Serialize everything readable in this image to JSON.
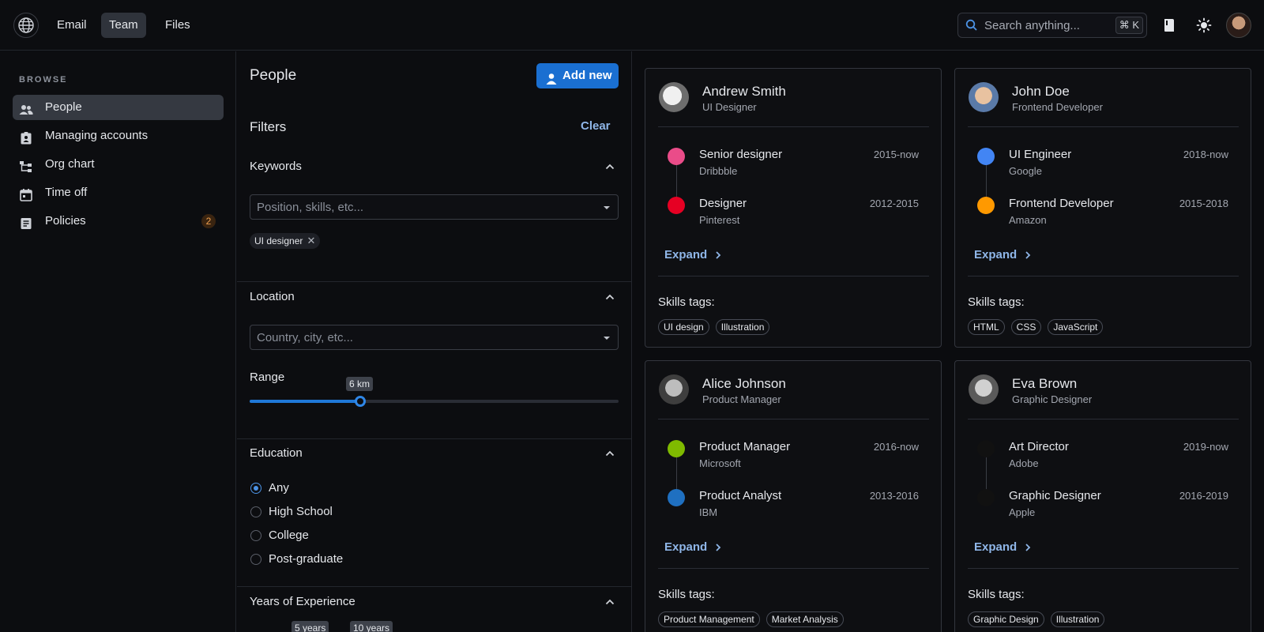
{
  "topbar": {
    "nav": [
      {
        "label": "Email",
        "active": false
      },
      {
        "label": "Team",
        "active": true
      },
      {
        "label": "Files",
        "active": false
      }
    ],
    "search": {
      "placeholder": "Search anything...",
      "shortcut": "⌘ K"
    },
    "icons": [
      "globe-icon",
      "book-icon",
      "sun-icon",
      "avatar"
    ]
  },
  "sidebar": {
    "section_label": "BROWSE",
    "items": [
      {
        "label": "People",
        "icon": "people-icon",
        "active": true
      },
      {
        "label": "Managing accounts",
        "icon": "badge-icon"
      },
      {
        "label": "Org chart",
        "icon": "org-chart-icon"
      },
      {
        "label": "Time off",
        "icon": "calendar-icon"
      },
      {
        "label": "Policies",
        "icon": "document-icon",
        "badge": "2"
      }
    ]
  },
  "filters": {
    "page_title": "People",
    "add_button": "Add new",
    "title": "Filters",
    "clear": "Clear",
    "keywords": {
      "heading": "Keywords",
      "placeholder": "Position, skills, etc...",
      "chips": [
        "UI designer"
      ]
    },
    "location": {
      "heading": "Location",
      "placeholder": "Country, city, etc...",
      "range_label": "Range",
      "range_value": "6 km",
      "range_fraction": 0.3
    },
    "education": {
      "heading": "Education",
      "options": [
        "Any",
        "High School",
        "College",
        "Post-graduate"
      ],
      "selected": "Any"
    },
    "experience": {
      "heading": "Years of Experience",
      "min_label": "5 years",
      "max_label": "10 years"
    }
  },
  "accent_color": "#1a6fd1",
  "cards": [
    {
      "name": "Andrew Smith",
      "role": "UI Designer",
      "jobs": [
        {
          "title": "Senior designer",
          "company": "Dribbble",
          "dates": "2015-now",
          "color": "#ea4c89"
        },
        {
          "title": "Designer",
          "company": "Pinterest",
          "dates": "2012-2015",
          "color": "#e60023"
        }
      ],
      "expand": "Expand",
      "skills_label": "Skills tags:",
      "tags": [
        "UI design",
        "Illustration"
      ]
    },
    {
      "name": "John Doe",
      "role": "Frontend Developer",
      "jobs": [
        {
          "title": "UI Engineer",
          "company": "Google",
          "dates": "2018-now",
          "color": "#4285f4"
        },
        {
          "title": "Frontend Developer",
          "company": "Amazon",
          "dates": "2015-2018",
          "color": "#ff9900"
        }
      ],
      "expand": "Expand",
      "skills_label": "Skills tags:",
      "tags": [
        "HTML",
        "CSS",
        "JavaScript"
      ]
    },
    {
      "name": "Alice Johnson",
      "role": "Product Manager",
      "jobs": [
        {
          "title": "Product Manager",
          "company": "Microsoft",
          "dates": "2016-now",
          "color": "#7fba00"
        },
        {
          "title": "Product Analyst",
          "company": "IBM",
          "dates": "2013-2016",
          "color": "#1f70c1"
        }
      ],
      "expand": "Expand",
      "skills_label": "Skills tags:",
      "tags": [
        "Product Management",
        "Market Analysis"
      ]
    },
    {
      "name": "Eva Brown",
      "role": "Graphic Designer",
      "jobs": [
        {
          "title": "Art Director",
          "company": "Adobe",
          "dates": "2019-now",
          "color": "#111111"
        },
        {
          "title": "Graphic Designer",
          "company": "Apple",
          "dates": "2016-2019",
          "color": "#111111"
        }
      ],
      "expand": "Expand",
      "skills_label": "Skills tags:",
      "tags": [
        "Graphic Design",
        "Illustration"
      ]
    }
  ]
}
